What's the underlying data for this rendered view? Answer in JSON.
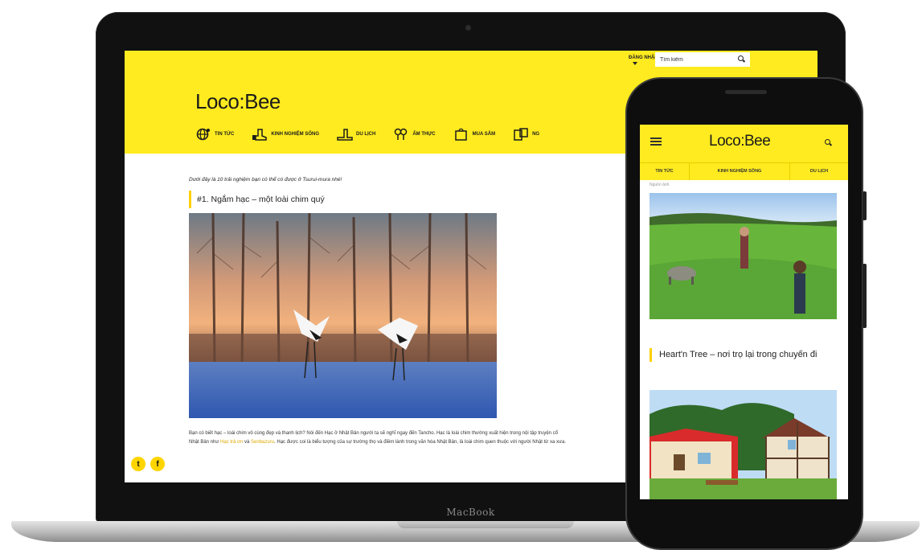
{
  "device_label": "MacBook",
  "site": {
    "logo": "Loco:Bee",
    "top_link": "ĐĂNG NHẬP",
    "search_value": "Tìm kiếm",
    "nav": [
      {
        "label": "TIN TỨC",
        "icon": "globe-icon"
      },
      {
        "label": "KINH NGHIỆM SỐNG",
        "icon": "boot-icon"
      },
      {
        "label": "DU LỊCH",
        "icon": "mountain-icon"
      },
      {
        "label": "ẨM THỰC",
        "icon": "utensils-icon"
      },
      {
        "label": "MUA SẮM",
        "icon": "shopping-bag-icon"
      },
      {
        "label": "NG",
        "icon": "flag-icon"
      }
    ]
  },
  "article": {
    "intro": "Dưới đây là 10 trải nghiệm bạn có thể có được ở Tsurui-mura nhé!",
    "heading": "#1. Ngắm hạc – một loài chim quý",
    "para_1": "Bạn có biết hạc – loài chim vô cùng đẹp và thanh lịch? Nói đến Hạc ở Nhật Bản người ta sẽ nghĩ ngay đến Tancho. Hạc là loài chim thường xuất hiện trong nội tập truyện cổ Nhật Bản như ",
    "link_1": "Hạc trả ơn",
    "para_2": " và ",
    "link_2": "Senbazuru",
    "para_3": ". Hạc được coi là biểu tượng của sự trường thọ và điềm lành trong văn hóa Nhật Bản, là loài chim quen thuộc với người Nhật từ xa xưa."
  },
  "social": {
    "twitter": "t",
    "facebook": "f"
  },
  "mobile": {
    "logo": "Loco:Bee",
    "nav": [
      "TIN TỨC",
      "KINH NGHIỆM SỐNG",
      "DU LỊCH"
    ],
    "caption": "Nguồn ảnh",
    "heading": "Heart'n Tree – nơi trọ lại trong chuyến đi"
  }
}
